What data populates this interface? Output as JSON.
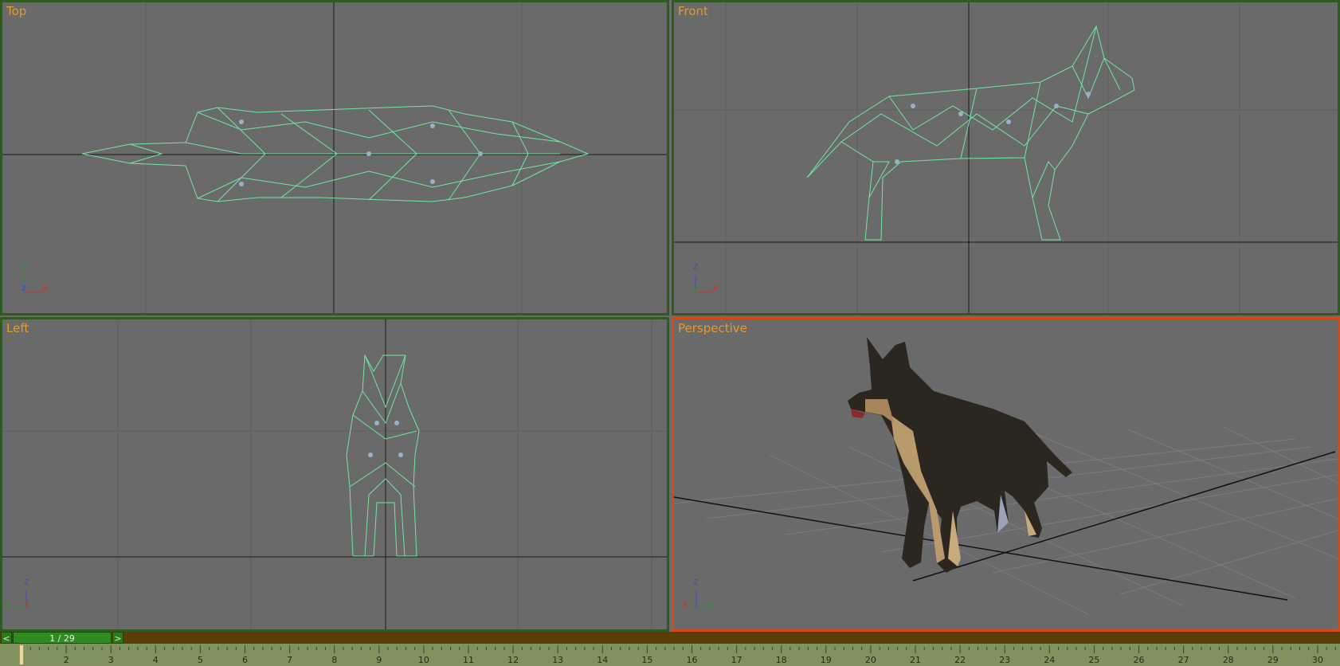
{
  "viewports": {
    "top": {
      "label": "Top",
      "axes": [
        "y",
        "z",
        "x"
      ]
    },
    "front": {
      "label": "Front",
      "axes": [
        "z",
        "y",
        "x"
      ]
    },
    "left": {
      "label": "Left",
      "axes": [
        "z",
        "y",
        "x"
      ]
    },
    "perspective": {
      "label": "Perspective",
      "axes": [
        "z",
        "x",
        "y"
      ]
    }
  },
  "timeline": {
    "prev_icon": "<",
    "next_icon": ">",
    "frame_display": "1 / 29",
    "current_frame": 1,
    "total_frames": 29,
    "ruler_labels": [
      "2",
      "3",
      "4",
      "5",
      "6",
      "7",
      "8",
      "9",
      "10",
      "11",
      "12",
      "13",
      "14",
      "15",
      "16",
      "17",
      "18",
      "19",
      "20",
      "21",
      "22",
      "23",
      "24",
      "25",
      "26",
      "27",
      "28",
      "29",
      "30"
    ]
  },
  "colors": {
    "viewport_bg": "#6a6a6a",
    "inactive_border": "#2f5b22",
    "active_border": "#d04a1a",
    "label": "#e49a2a",
    "wireframe": "#6ee8a0",
    "axis_x": "#c0392b",
    "axis_y": "#2e8b3a",
    "axis_z": "#3a4fd0"
  }
}
